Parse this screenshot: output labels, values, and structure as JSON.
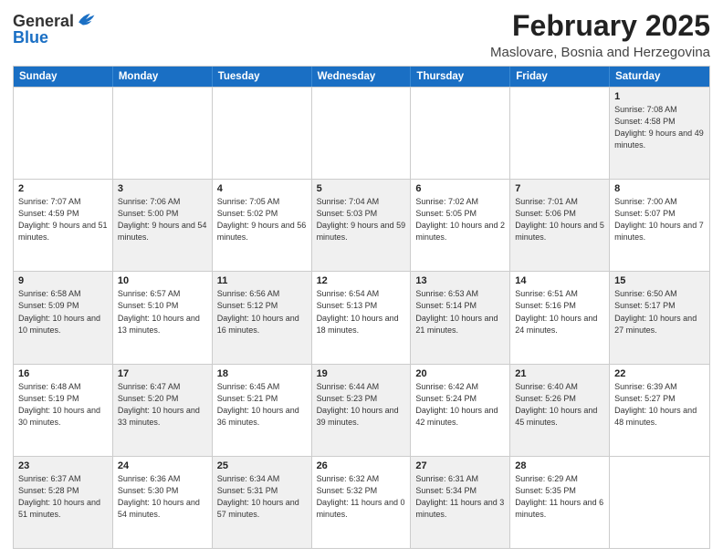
{
  "logo": {
    "line1": "General",
    "line2": "Blue"
  },
  "title": "February 2025",
  "subtitle": "Maslovare, Bosnia and Herzegovina",
  "days_of_week": [
    "Sunday",
    "Monday",
    "Tuesday",
    "Wednesday",
    "Thursday",
    "Friday",
    "Saturday"
  ],
  "weeks": [
    [
      {
        "day": "",
        "info": "",
        "shaded": false
      },
      {
        "day": "",
        "info": "",
        "shaded": false
      },
      {
        "day": "",
        "info": "",
        "shaded": false
      },
      {
        "day": "",
        "info": "",
        "shaded": false
      },
      {
        "day": "",
        "info": "",
        "shaded": false
      },
      {
        "day": "",
        "info": "",
        "shaded": false
      },
      {
        "day": "1",
        "info": "Sunrise: 7:08 AM\nSunset: 4:58 PM\nDaylight: 9 hours and 49 minutes.",
        "shaded": true
      }
    ],
    [
      {
        "day": "2",
        "info": "Sunrise: 7:07 AM\nSunset: 4:59 PM\nDaylight: 9 hours and 51 minutes.",
        "shaded": false
      },
      {
        "day": "3",
        "info": "Sunrise: 7:06 AM\nSunset: 5:00 PM\nDaylight: 9 hours and 54 minutes.",
        "shaded": true
      },
      {
        "day": "4",
        "info": "Sunrise: 7:05 AM\nSunset: 5:02 PM\nDaylight: 9 hours and 56 minutes.",
        "shaded": false
      },
      {
        "day": "5",
        "info": "Sunrise: 7:04 AM\nSunset: 5:03 PM\nDaylight: 9 hours and 59 minutes.",
        "shaded": true
      },
      {
        "day": "6",
        "info": "Sunrise: 7:02 AM\nSunset: 5:05 PM\nDaylight: 10 hours and 2 minutes.",
        "shaded": false
      },
      {
        "day": "7",
        "info": "Sunrise: 7:01 AM\nSunset: 5:06 PM\nDaylight: 10 hours and 5 minutes.",
        "shaded": true
      },
      {
        "day": "8",
        "info": "Sunrise: 7:00 AM\nSunset: 5:07 PM\nDaylight: 10 hours and 7 minutes.",
        "shaded": false
      }
    ],
    [
      {
        "day": "9",
        "info": "Sunrise: 6:58 AM\nSunset: 5:09 PM\nDaylight: 10 hours and 10 minutes.",
        "shaded": true
      },
      {
        "day": "10",
        "info": "Sunrise: 6:57 AM\nSunset: 5:10 PM\nDaylight: 10 hours and 13 minutes.",
        "shaded": false
      },
      {
        "day": "11",
        "info": "Sunrise: 6:56 AM\nSunset: 5:12 PM\nDaylight: 10 hours and 16 minutes.",
        "shaded": true
      },
      {
        "day": "12",
        "info": "Sunrise: 6:54 AM\nSunset: 5:13 PM\nDaylight: 10 hours and 18 minutes.",
        "shaded": false
      },
      {
        "day": "13",
        "info": "Sunrise: 6:53 AM\nSunset: 5:14 PM\nDaylight: 10 hours and 21 minutes.",
        "shaded": true
      },
      {
        "day": "14",
        "info": "Sunrise: 6:51 AM\nSunset: 5:16 PM\nDaylight: 10 hours and 24 minutes.",
        "shaded": false
      },
      {
        "day": "15",
        "info": "Sunrise: 6:50 AM\nSunset: 5:17 PM\nDaylight: 10 hours and 27 minutes.",
        "shaded": true
      }
    ],
    [
      {
        "day": "16",
        "info": "Sunrise: 6:48 AM\nSunset: 5:19 PM\nDaylight: 10 hours and 30 minutes.",
        "shaded": false
      },
      {
        "day": "17",
        "info": "Sunrise: 6:47 AM\nSunset: 5:20 PM\nDaylight: 10 hours and 33 minutes.",
        "shaded": true
      },
      {
        "day": "18",
        "info": "Sunrise: 6:45 AM\nSunset: 5:21 PM\nDaylight: 10 hours and 36 minutes.",
        "shaded": false
      },
      {
        "day": "19",
        "info": "Sunrise: 6:44 AM\nSunset: 5:23 PM\nDaylight: 10 hours and 39 minutes.",
        "shaded": true
      },
      {
        "day": "20",
        "info": "Sunrise: 6:42 AM\nSunset: 5:24 PM\nDaylight: 10 hours and 42 minutes.",
        "shaded": false
      },
      {
        "day": "21",
        "info": "Sunrise: 6:40 AM\nSunset: 5:26 PM\nDaylight: 10 hours and 45 minutes.",
        "shaded": true
      },
      {
        "day": "22",
        "info": "Sunrise: 6:39 AM\nSunset: 5:27 PM\nDaylight: 10 hours and 48 minutes.",
        "shaded": false
      }
    ],
    [
      {
        "day": "23",
        "info": "Sunrise: 6:37 AM\nSunset: 5:28 PM\nDaylight: 10 hours and 51 minutes.",
        "shaded": true
      },
      {
        "day": "24",
        "info": "Sunrise: 6:36 AM\nSunset: 5:30 PM\nDaylight: 10 hours and 54 minutes.",
        "shaded": false
      },
      {
        "day": "25",
        "info": "Sunrise: 6:34 AM\nSunset: 5:31 PM\nDaylight: 10 hours and 57 minutes.",
        "shaded": true
      },
      {
        "day": "26",
        "info": "Sunrise: 6:32 AM\nSunset: 5:32 PM\nDaylight: 11 hours and 0 minutes.",
        "shaded": false
      },
      {
        "day": "27",
        "info": "Sunrise: 6:31 AM\nSunset: 5:34 PM\nDaylight: 11 hours and 3 minutes.",
        "shaded": true
      },
      {
        "day": "28",
        "info": "Sunrise: 6:29 AM\nSunset: 5:35 PM\nDaylight: 11 hours and 6 minutes.",
        "shaded": false
      },
      {
        "day": "",
        "info": "",
        "shaded": false
      }
    ]
  ]
}
